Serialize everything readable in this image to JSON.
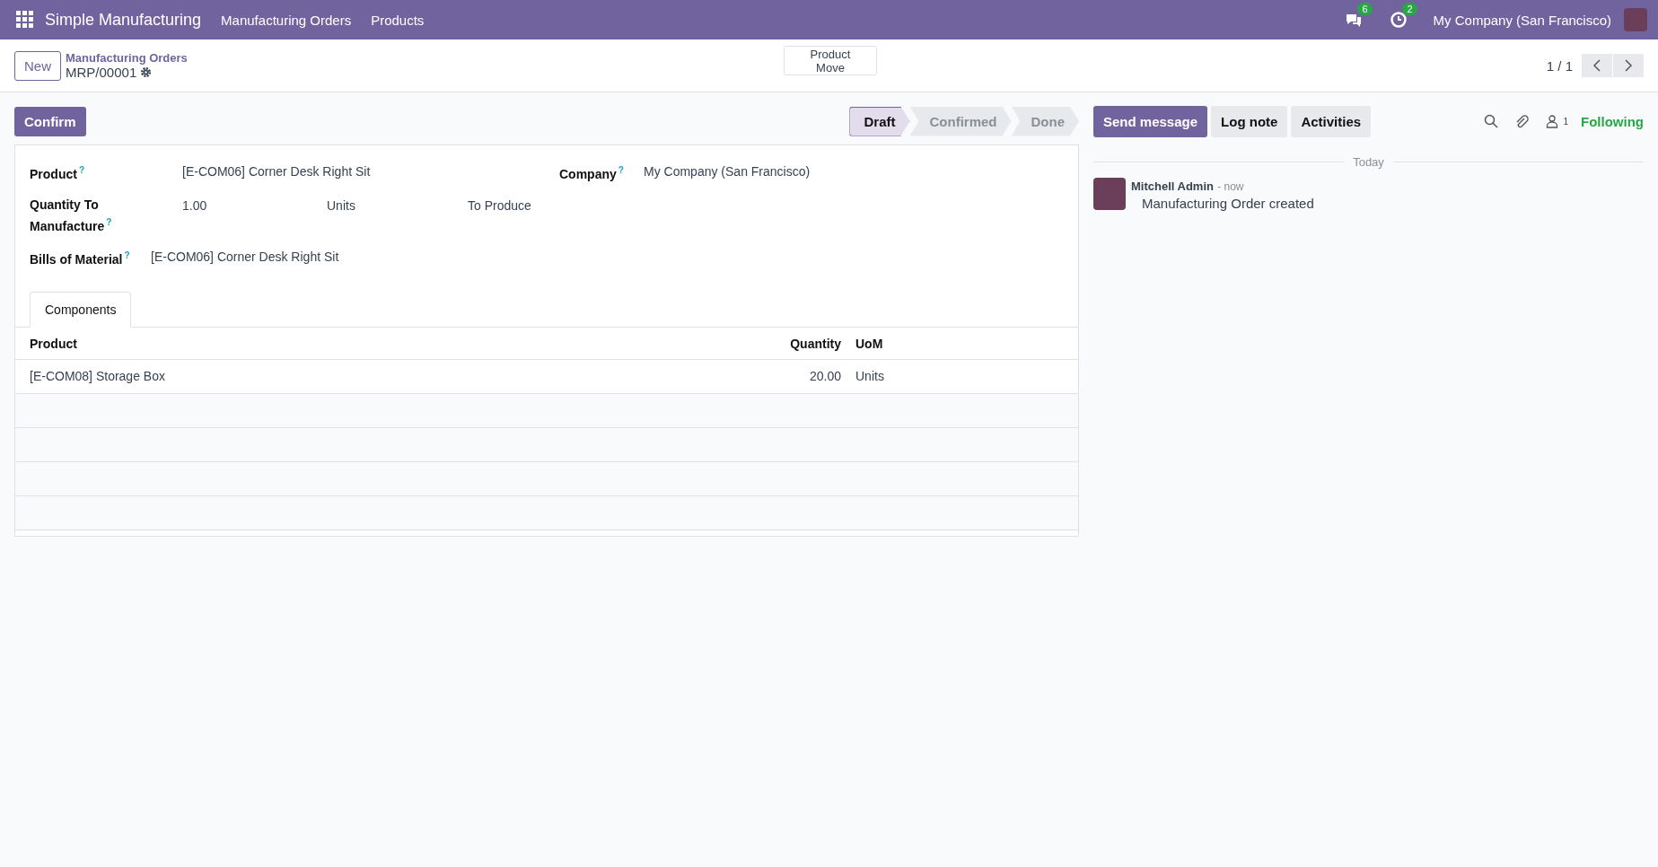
{
  "navbar": {
    "app_name": "Simple Manufacturing",
    "menu": [
      "Manufacturing Orders",
      "Products"
    ],
    "messages_badge": "6",
    "activities_badge": "2",
    "company": "My Company (San Francisco)"
  },
  "breadcrumb": {
    "new_button": "New",
    "parent": "Manufacturing Orders",
    "record": "MRP/00001"
  },
  "smart_button": "Product Move",
  "pager": "1 / 1",
  "actions": [
    "Confirm"
  ],
  "stages": [
    {
      "label": "Draft",
      "selected": true
    },
    {
      "label": "Confirmed",
      "selected": false
    },
    {
      "label": "Done",
      "selected": false
    }
  ],
  "form": {
    "product": {
      "label": "Product",
      "help": "?",
      "value": "[E-COM06] Corner Desk Right Sit"
    },
    "company": {
      "label": "Company",
      "help": "?",
      "value": "My Company (San Francisco)"
    },
    "quantity": {
      "label": "Quantity To Manufacture",
      "help": "?",
      "value": "1.00",
      "unit": "Units",
      "suffix": "To Produce"
    },
    "bom": {
      "label": "Bills of Material",
      "help": "?",
      "value": "[E-COM06] Corner Desk Right Sit"
    }
  },
  "tabs": [
    {
      "label": "Components",
      "selected": true
    }
  ],
  "table": {
    "columns": [
      "Product",
      "Quantity",
      "UoM"
    ],
    "rows": [
      {
        "product": "[E-COM08] Storage Box",
        "quantity": "20.00",
        "uom": "Units"
      }
    ]
  },
  "chatter": {
    "buttons": [
      {
        "label": "Send message",
        "kind": "primary"
      },
      {
        "label": "Log note",
        "kind": "secondary"
      },
      {
        "label": "Activities",
        "kind": "secondary"
      }
    ],
    "followers_count": "1",
    "following": "Following",
    "date_separator": "Today",
    "messages": [
      {
        "author": "Mitchell Admin",
        "time": "- now",
        "body": "Manufacturing Order created"
      }
    ]
  }
}
